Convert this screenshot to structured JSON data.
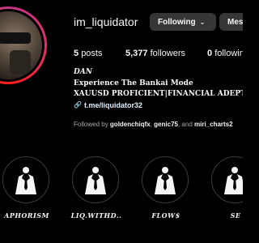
{
  "profile": {
    "username": "im_liquidator",
    "following_button": "Following",
    "message_button": "Mes"
  },
  "stats": {
    "posts_count": "5",
    "posts_label": "posts",
    "followers_count": "5,377",
    "followers_label": "followers",
    "following_count": "0",
    "following_label": "followin"
  },
  "bio": {
    "name": "DAN",
    "line1": "Experience The Bankai Mode",
    "line2": "XAUUSD PROFICIENT|FINANCIAL ADEPT",
    "link": "t.me/liquidator32"
  },
  "followed_by": {
    "prefix": "Followed by",
    "user1": "goldenchiqfx",
    "sep1": ",",
    "user2": "genic75",
    "sep2": ", and",
    "user3": "miri_charts2"
  },
  "highlights": [
    {
      "label": "APHORISM",
      "icon": "suit-tie-icon"
    },
    {
      "label": "LIQ.WITHD..",
      "icon": "suit-tie-icon"
    },
    {
      "label": "FLOW$",
      "icon": "suit-tie-icon"
    },
    {
      "label": "SE",
      "icon": "suit-tie-icon"
    }
  ],
  "colors": {
    "background": "#000000",
    "button": "#363636",
    "link": "#e0f1ff",
    "muted_text": "#a8a8a8"
  }
}
